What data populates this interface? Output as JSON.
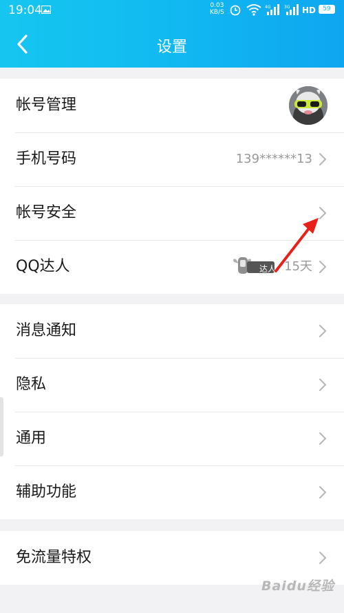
{
  "status": {
    "time": "19:04",
    "speed_value": "0.03",
    "speed_unit": "KB/S",
    "battery": "59"
  },
  "nav": {
    "title": "设置"
  },
  "groups": [
    {
      "items": [
        {
          "label": "帐号管理",
          "kind": "avatar"
        },
        {
          "label": "手机号码",
          "value": "139******13"
        },
        {
          "label": "帐号安全"
        },
        {
          "label": "QQ达人",
          "badge_text": "达人",
          "value": "15天"
        }
      ]
    },
    {
      "items": [
        {
          "label": "消息通知"
        },
        {
          "label": "隐私"
        },
        {
          "label": "通用"
        },
        {
          "label": "辅助功能"
        }
      ]
    },
    {
      "items": [
        {
          "label": "免流量特权"
        }
      ]
    }
  ],
  "watermark": "Baidu经验",
  "colors": {
    "header": "#11b9f1",
    "annotation_arrow": "#e8201a"
  }
}
